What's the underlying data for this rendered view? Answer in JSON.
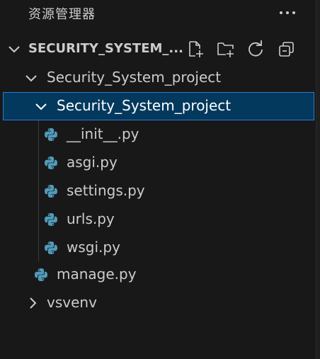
{
  "explorer": {
    "title": "资源管理器",
    "more_icon": "ellipsis-icon"
  },
  "section": {
    "title": "SECURITY_SYSTEM_...",
    "actions": [
      "new-file-icon",
      "new-folder-icon",
      "refresh-icon",
      "collapse-all-icon"
    ]
  },
  "tree": {
    "folder_outer": "Security_System_project",
    "folder_inner": "Security_System_project",
    "files": {
      "init": "__init__.py",
      "asgi": "asgi.py",
      "settings": "settings.py",
      "urls": "urls.py",
      "wsgi": "wsgi.py"
    },
    "manage": "manage.py",
    "vsvenv": "vsvenv"
  },
  "colors": {
    "background": "#181818",
    "selection_bg": "#04395e",
    "selection_border": "#2b79d6",
    "python_icon": "#519aba"
  }
}
